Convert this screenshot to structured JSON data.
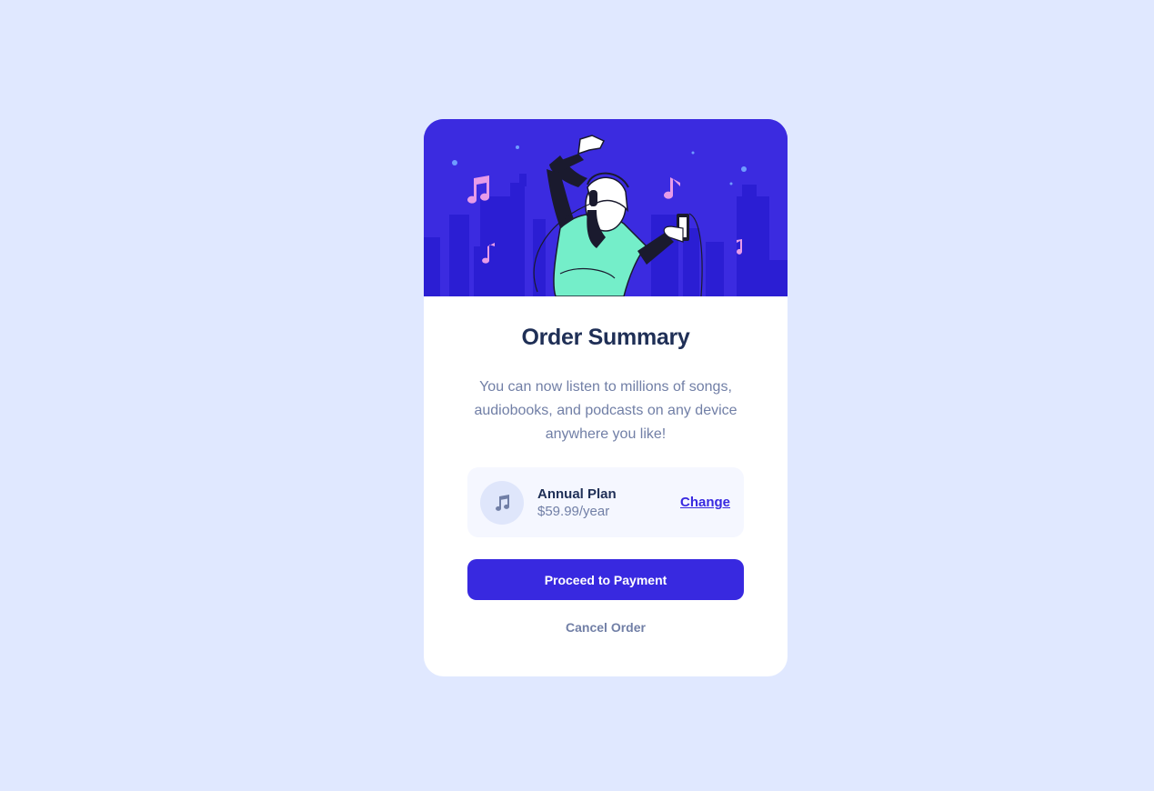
{
  "card": {
    "title": "Order Summary",
    "description": "You can now listen to millions of songs, audiobooks, and podcasts on any device anywhere you like!"
  },
  "plan": {
    "icon": "music-note-icon",
    "name": "Annual Plan",
    "price": "$59.99/year",
    "change_label": "Change"
  },
  "actions": {
    "proceed_label": "Proceed to Payment",
    "cancel_label": "Cancel Order"
  },
  "colors": {
    "page_background": "#e0e8ff",
    "accent": "#3829e0",
    "heading": "#1f2f56",
    "muted_text": "#717fa6",
    "plan_background": "#f5f7ff"
  }
}
